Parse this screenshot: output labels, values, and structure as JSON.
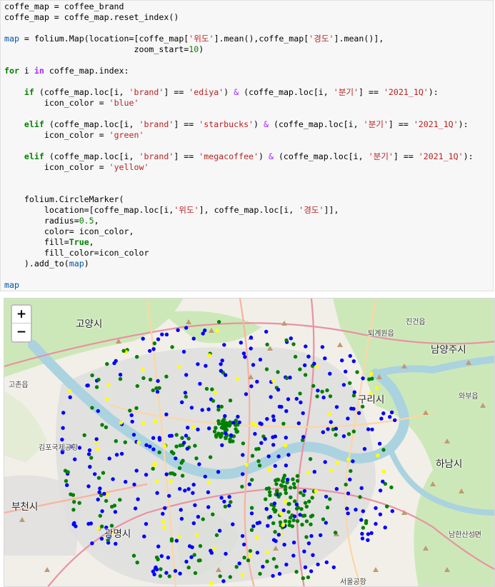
{
  "code_cell": {
    "lines": [
      [
        {
          "t": "coffe_map = coffee_brand",
          "c": ""
        }
      ],
      [
        {
          "t": "coffe_map = coffe_map.reset_index()",
          "c": ""
        }
      ],
      [],
      [
        {
          "t": "map",
          "c": "var"
        },
        {
          "t": " = folium.Map(location=[coffe_map[",
          "c": ""
        },
        {
          "t": "'위도'",
          "c": "str"
        },
        {
          "t": "].mean(),coffe_map[",
          "c": ""
        },
        {
          "t": "'경도'",
          "c": "str"
        },
        {
          "t": "].mean()],",
          "c": ""
        }
      ],
      [
        {
          "t": "                          zoom_start=",
          "c": ""
        },
        {
          "t": "10",
          "c": "num"
        },
        {
          "t": ")",
          "c": ""
        }
      ],
      [],
      [
        {
          "t": "for",
          "c": "kw"
        },
        {
          "t": " i ",
          "c": ""
        },
        {
          "t": "in",
          "c": "ow"
        },
        {
          "t": " coffe_map.index:",
          "c": ""
        }
      ],
      [],
      [
        {
          "t": "    ",
          "c": ""
        },
        {
          "t": "if",
          "c": "kw"
        },
        {
          "t": " (coffe_map.loc[i, ",
          "c": ""
        },
        {
          "t": "'brand'",
          "c": "str"
        },
        {
          "t": "] == ",
          "c": ""
        },
        {
          "t": "'ediya'",
          "c": "str"
        },
        {
          "t": ") ",
          "c": ""
        },
        {
          "t": "&",
          "c": "op"
        },
        {
          "t": " (coffe_map.loc[i, ",
          "c": ""
        },
        {
          "t": "'분기'",
          "c": "str"
        },
        {
          "t": "] == ",
          "c": ""
        },
        {
          "t": "'2021_1Q'",
          "c": "str"
        },
        {
          "t": "):",
          "c": ""
        }
      ],
      [
        {
          "t": "        icon_color = ",
          "c": ""
        },
        {
          "t": "'blue'",
          "c": "str"
        }
      ],
      [],
      [
        {
          "t": "    ",
          "c": ""
        },
        {
          "t": "elif",
          "c": "kw"
        },
        {
          "t": " (coffe_map.loc[i, ",
          "c": ""
        },
        {
          "t": "'brand'",
          "c": "str"
        },
        {
          "t": "] == ",
          "c": ""
        },
        {
          "t": "'starbucks'",
          "c": "str"
        },
        {
          "t": ") ",
          "c": ""
        },
        {
          "t": "&",
          "c": "op"
        },
        {
          "t": " (coffe_map.loc[i, ",
          "c": ""
        },
        {
          "t": "'분기'",
          "c": "str"
        },
        {
          "t": "] == ",
          "c": ""
        },
        {
          "t": "'2021_1Q'",
          "c": "str"
        },
        {
          "t": "):",
          "c": ""
        }
      ],
      [
        {
          "t": "        icon_color = ",
          "c": ""
        },
        {
          "t": "'green'",
          "c": "str"
        }
      ],
      [],
      [
        {
          "t": "    ",
          "c": ""
        },
        {
          "t": "elif",
          "c": "kw"
        },
        {
          "t": " (coffe_map.loc[i, ",
          "c": ""
        },
        {
          "t": "'brand'",
          "c": "str"
        },
        {
          "t": "] == ",
          "c": ""
        },
        {
          "t": "'megacoffee'",
          "c": "str"
        },
        {
          "t": ") ",
          "c": ""
        },
        {
          "t": "&",
          "c": "op"
        },
        {
          "t": " (coffe_map.loc[i, ",
          "c": ""
        },
        {
          "t": "'분기'",
          "c": "str"
        },
        {
          "t": "] == ",
          "c": ""
        },
        {
          "t": "'2021_1Q'",
          "c": "str"
        },
        {
          "t": "):",
          "c": ""
        }
      ],
      [
        {
          "t": "        icon_color = ",
          "c": ""
        },
        {
          "t": "'yellow'",
          "c": "str"
        }
      ],
      [],
      [],
      [
        {
          "t": "    folium.CircleMarker(",
          "c": ""
        }
      ],
      [
        {
          "t": "        location=[coffe_map.loc[i,",
          "c": ""
        },
        {
          "t": "'위도'",
          "c": "str"
        },
        {
          "t": "], coffe_map.loc[i, ",
          "c": ""
        },
        {
          "t": "'경도'",
          "c": "str"
        },
        {
          "t": "]],",
          "c": ""
        }
      ],
      [
        {
          "t": "        radius=",
          "c": ""
        },
        {
          "t": "0.5",
          "c": "num"
        },
        {
          "t": ",",
          "c": ""
        }
      ],
      [
        {
          "t": "        color= icon_color,",
          "c": ""
        }
      ],
      [
        {
          "t": "        fill=",
          "c": ""
        },
        {
          "t": "True",
          "c": "kw"
        },
        {
          "t": ",",
          "c": ""
        }
      ],
      [
        {
          "t": "        fill_color=icon_color",
          "c": ""
        }
      ],
      [
        {
          "t": "    ).add_to(",
          "c": ""
        },
        {
          "t": "map",
          "c": "var"
        },
        {
          "t": ")",
          "c": ""
        }
      ],
      [],
      [
        {
          "t": "map",
          "c": "var"
        }
      ]
    ]
  },
  "map": {
    "zoom_in_label": "+",
    "zoom_out_label": "−",
    "place_labels": {
      "goyang": "고양시",
      "bucheon": "부천시",
      "gwangmyeong": "광명시",
      "guri": "구리시",
      "namyangju": "남양주시",
      "hanam": "하남시",
      "gochon": "고촌읍",
      "toegyewon": "퇴계원읍",
      "jingeon": "진건읍",
      "wabu": "와부읍",
      "gimpo_airport": "김포국제공항",
      "namhansanseong": "남한산성면",
      "seoul_airport": "서울공항"
    },
    "marker_colors": {
      "ediya": "#0000ff",
      "starbucks": "#008000",
      "megacoffee": "#ffff00"
    },
    "colors": {
      "river": "#aad3df",
      "green_area": "#cde8b8",
      "urban": "#dedede",
      "motorway": "#e892a2",
      "trunk": "#f9b29c",
      "primary": "#fcd6a4",
      "peak": "#c09a70"
    }
  }
}
